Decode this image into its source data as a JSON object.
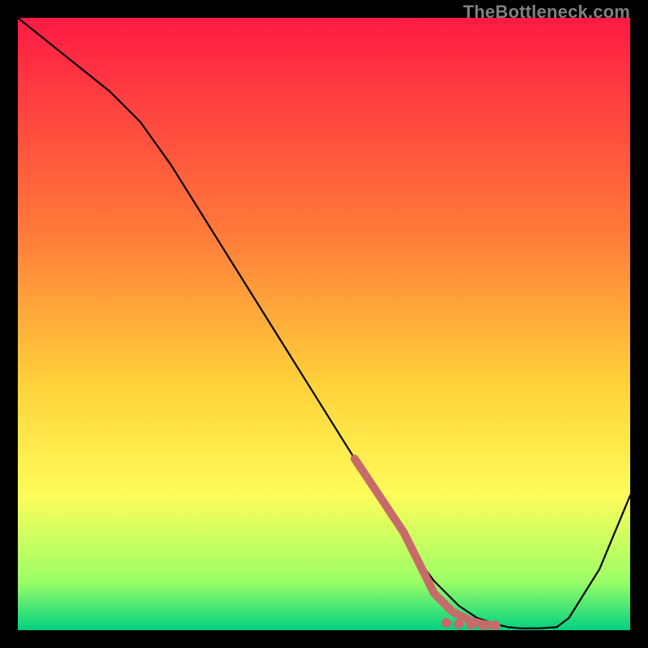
{
  "watermark": "TheBottleneck.com",
  "colors": {
    "gradient_top": "#ff1a44",
    "gradient_mid1": "#ff7a3a",
    "gradient_mid2": "#ffd23a",
    "gradient_mid3": "#fdfd5a",
    "gradient_bottom1": "#9cff66",
    "gradient_bottom2": "#00d082",
    "line": "#000000",
    "dots": "#c76a6a",
    "dots_thick": "#c76a6a"
  },
  "chart_data": {
    "type": "line",
    "title": "",
    "xlabel": "",
    "ylabel": "",
    "xlim": [
      0,
      100
    ],
    "ylim": [
      0,
      100
    ],
    "grid": false,
    "series": [
      {
        "name": "bottleneck-curve",
        "x": [
          0,
          5,
          10,
          15,
          20,
          25,
          30,
          35,
          40,
          45,
          50,
          55,
          60,
          62,
          65,
          68,
          70,
          72,
          75,
          78,
          80,
          82,
          85,
          88,
          90,
          95,
          100
        ],
        "y": [
          100,
          96,
          92,
          88,
          83,
          76,
          68,
          60,
          52,
          44,
          36,
          28,
          20,
          17,
          12,
          8,
          6,
          4,
          2,
          1,
          0.5,
          0.3,
          0.3,
          0.5,
          2,
          10,
          22
        ]
      }
    ],
    "highlight_segment": {
      "name": "optimal-range",
      "x": [
        55,
        57,
        59,
        61,
        63,
        65,
        67,
        68,
        70,
        71,
        72,
        73,
        74,
        76,
        78
      ],
      "y": [
        28,
        25,
        22,
        19,
        16,
        12,
        8,
        6,
        4,
        3,
        2.5,
        2,
        1.5,
        1,
        0.7
      ]
    },
    "dots": {
      "name": "optimal-dots",
      "points": [
        {
          "x": 70,
          "y": 1.2
        },
        {
          "x": 72,
          "y": 1.0
        },
        {
          "x": 74,
          "y": 0.9
        },
        {
          "x": 76,
          "y": 0.8
        },
        {
          "x": 78,
          "y": 0.8
        }
      ]
    }
  }
}
